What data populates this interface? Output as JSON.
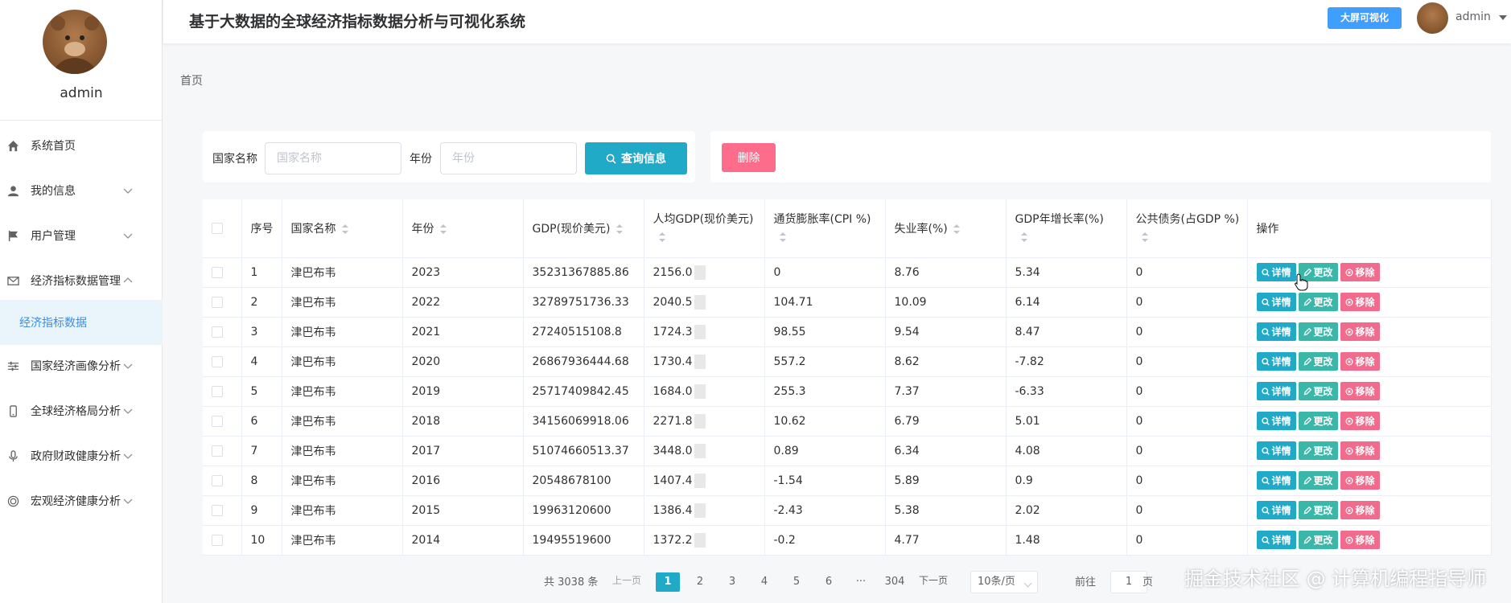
{
  "sidebar": {
    "username": "admin",
    "items": [
      {
        "label": "系统首页",
        "icon": "home-icon",
        "has_chevron": false
      },
      {
        "label": "我的信息",
        "icon": "user-icon",
        "has_chevron": true
      },
      {
        "label": "用户管理",
        "icon": "flag-icon",
        "has_chevron": true
      },
      {
        "label": "经济指标数据管理",
        "icon": "mail-icon",
        "has_chevron": true,
        "expanded": true
      },
      {
        "label": "经济指标数据",
        "icon": "",
        "sub": true,
        "active": true
      },
      {
        "label": "国家经济画像分析",
        "icon": "sliders-icon",
        "has_chevron": true
      },
      {
        "label": "全球经济格局分析",
        "icon": "phone-icon",
        "has_chevron": true
      },
      {
        "label": "政府财政健康分析",
        "icon": "microphone-icon",
        "has_chevron": true
      },
      {
        "label": "宏观经济健康分析",
        "icon": "target-icon",
        "has_chevron": true
      }
    ]
  },
  "header": {
    "title": "基于大数据的全球经济指标数据分析与可视化系统",
    "bigscreen_label": "大屏可视化",
    "username": "admin"
  },
  "breadcrumb": "首页",
  "search": {
    "country_label": "国家名称",
    "country_placeholder": "国家名称",
    "year_label": "年份",
    "year_placeholder": "年份",
    "query_label": "查询信息"
  },
  "actions": {
    "delete_label": "删除"
  },
  "table": {
    "headers": [
      "序号",
      "国家名称",
      "年份",
      "GDP(现价美元)",
      "人均GDP(现价美元)",
      "通货膨胀率(CPI %)",
      "失业率(%)",
      "GDP年增长率(%)",
      "公共债务(占GDP %)",
      "操作"
    ],
    "row_actions": {
      "detail": "详情",
      "edit": "更改",
      "remove": "移除"
    },
    "rows": [
      [
        "1",
        "津巴布韦",
        "2023",
        "35231367885.86",
        "2156.0",
        "0",
        "8.76",
        "5.34",
        "0"
      ],
      [
        "2",
        "津巴布韦",
        "2022",
        "32789751736.33",
        "2040.5",
        "104.71",
        "10.09",
        "6.14",
        "0"
      ],
      [
        "3",
        "津巴布韦",
        "2021",
        "27240515108.8",
        "1724.3",
        "98.55",
        "9.54",
        "8.47",
        "0"
      ],
      [
        "4",
        "津巴布韦",
        "2020",
        "26867936444.68",
        "1730.4",
        "557.2",
        "8.62",
        "-7.82",
        "0"
      ],
      [
        "5",
        "津巴布韦",
        "2019",
        "25717409842.45",
        "1684.0",
        "255.3",
        "7.37",
        "-6.33",
        "0"
      ],
      [
        "6",
        "津巴布韦",
        "2018",
        "34156069918.06",
        "2271.8",
        "10.62",
        "6.79",
        "5.01",
        "0"
      ],
      [
        "7",
        "津巴布韦",
        "2017",
        "51074660513.37",
        "3448.0",
        "0.89",
        "6.34",
        "4.08",
        "0"
      ],
      [
        "8",
        "津巴布韦",
        "2016",
        "20548678100",
        "1407.4",
        "-1.54",
        "5.89",
        "0.9",
        "0"
      ],
      [
        "9",
        "津巴布韦",
        "2015",
        "19963120600",
        "1386.4",
        "-2.43",
        "5.38",
        "2.02",
        "0"
      ],
      [
        "10",
        "津巴布韦",
        "2014",
        "19495519600",
        "1372.2",
        "-0.2",
        "4.77",
        "1.48",
        "0"
      ]
    ]
  },
  "pagination": {
    "total": "共 3038 条",
    "prev": "上一页",
    "pages": [
      "1",
      "2",
      "3",
      "4",
      "5",
      "6"
    ],
    "ellipsis": "···",
    "last": "304",
    "next": "下一页",
    "page_size": "10条/页",
    "goto_label": "前往",
    "goto_value": "1",
    "page_suffix": "页"
  },
  "watermark": "掘金技术社区 @ 计算机编程指导师",
  "colors": {
    "primary": "#21a9c8",
    "edit": "#3ab7a8",
    "danger": "#f06b8c",
    "blue": "#409eff"
  }
}
